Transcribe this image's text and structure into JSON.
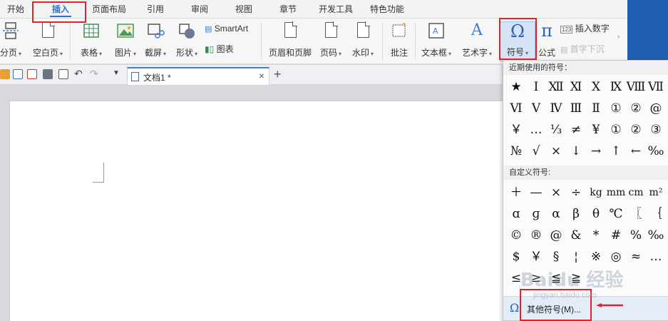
{
  "menu": {
    "tabs": [
      "开始",
      "插入",
      "页面布局",
      "引用",
      "审阅",
      "视图",
      "章节",
      "开发工具",
      "特色功能"
    ],
    "active_index": 1
  },
  "ribbon": {
    "page_break": "分页",
    "blank_page": "空白页",
    "table": "表格",
    "picture": "图片",
    "screenshot": "截屏",
    "shapes": "形状",
    "smartart": "SmartArt",
    "chart": "图表",
    "header_footer": "页眉和页脚",
    "page_number": "页码",
    "watermark": "水印",
    "comment": "批注",
    "textbox": "文本框",
    "wordart": "艺术字",
    "symbol": "符号",
    "formula": "公式",
    "insert_number": "插入数字",
    "drop_cap": "首字下沉"
  },
  "document": {
    "tab_title": "文档1 *"
  },
  "symbol_dropdown": {
    "recent_title": "近期使用的符号：",
    "recent_symbols": [
      "★",
      "Ⅰ",
      "Ⅻ",
      "Ⅺ",
      "Ⅹ",
      "Ⅸ",
      "Ⅷ",
      "Ⅶ",
      "Ⅵ",
      "Ⅴ",
      "Ⅳ",
      "Ⅲ",
      "Ⅱ",
      "①",
      "②",
      "@",
      "￥",
      "…",
      "⅓",
      "≠",
      "¥",
      "①",
      "②",
      "③",
      "№",
      "√",
      "×",
      "↓",
      "→",
      "↑",
      "←",
      "‰"
    ],
    "custom_title": "自定义符号:",
    "custom_symbols": [
      "＋",
      "—",
      "×",
      "÷",
      "kg",
      "mm",
      "cm",
      "m²",
      "ɑ",
      "ɡ",
      "α",
      "β",
      "θ",
      "℃",
      "〖",
      "｛",
      "©",
      "®",
      "@",
      "&",
      "*",
      "#",
      "%",
      "‰",
      "$",
      "￥",
      "§",
      "¦",
      "※",
      "◎",
      "≈",
      "…",
      "≤",
      "≥",
      "≦",
      "≧"
    ],
    "more_symbols": "其他符号(M)...",
    "more_icon": "omega-icon"
  },
  "colors": {
    "accent": "#2f6fd0",
    "annotation": "#e1232a",
    "side_panel": "#1f5fb0"
  }
}
